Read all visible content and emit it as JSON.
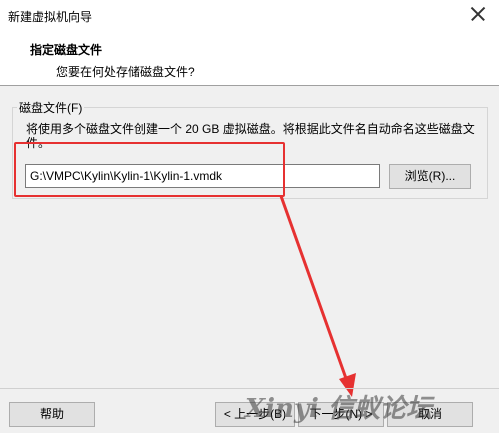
{
  "window": {
    "title": "新建虚拟机向导"
  },
  "header": {
    "title": "指定磁盘文件",
    "subtitle": "您要在何处存储磁盘文件?"
  },
  "disk_file": {
    "group_label": "磁盘文件(F)",
    "description": "将使用多个磁盘文件创建一个 20 GB 虚拟磁盘。将根据此文件名自动命名这些磁盘文件。",
    "path": "G:\\VMPC\\Kylin\\Kylin-1\\Kylin-1.vmdk",
    "browse_label": "浏览(R)..."
  },
  "footer": {
    "help_label": "帮助",
    "back_label": "< 上一步(B)",
    "next_label": "下一步(N) >",
    "cancel_label": "取消"
  },
  "annotation": {
    "color": "#e63131"
  },
  "watermark": "Xinyi 信蚁论坛"
}
